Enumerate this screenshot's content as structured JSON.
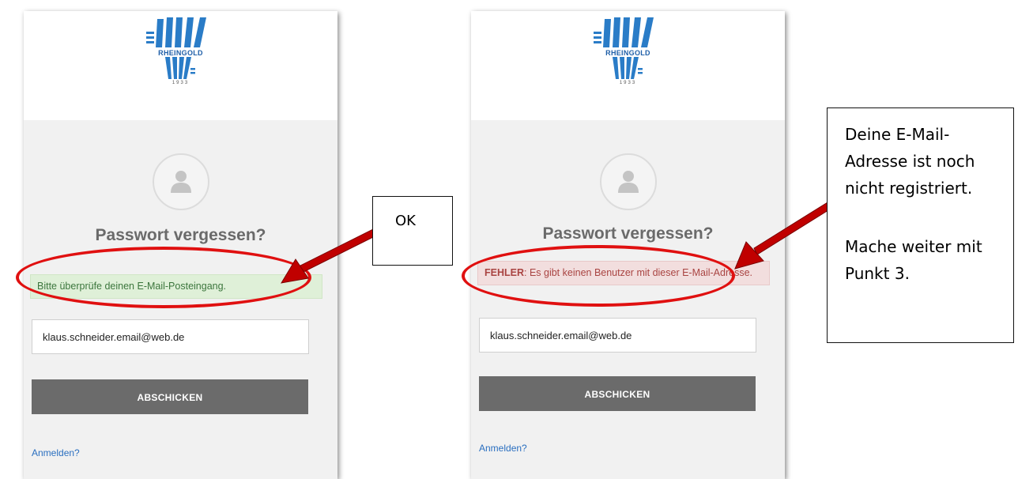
{
  "brand": {
    "name": "RHEINGOLD",
    "year": "1933"
  },
  "left_panel": {
    "title": "Passwort vergessen?",
    "message": "Bitte überprüfe deinen E-Mail-Posteingang.",
    "email_value": "klaus.schneider.email@web.de",
    "submit_label": "ABSCHICKEN",
    "login_link": "Anmelden?"
  },
  "right_panel": {
    "title": "Passwort vergessen?",
    "error_prefix": "FEHLER",
    "error_message": ": Es gibt keinen Benutzer mit dieser E-Mail-Adresse.",
    "email_value": "klaus.schneider.email@web.de",
    "submit_label": "ABSCHICKEN",
    "login_link": "Anmelden?"
  },
  "annotations": {
    "ok_label": "OK",
    "info_line1": "Deine E-Mail-Adresse ist noch nicht registriert.",
    "info_line2": "Mache weiter mit Punkt 3."
  },
  "colors": {
    "success_bg": "#dff0d8",
    "error_bg": "#f2dede",
    "button_bg": "#6b6b6b",
    "highlight": "#e01010",
    "link": "#2a6fc0"
  }
}
